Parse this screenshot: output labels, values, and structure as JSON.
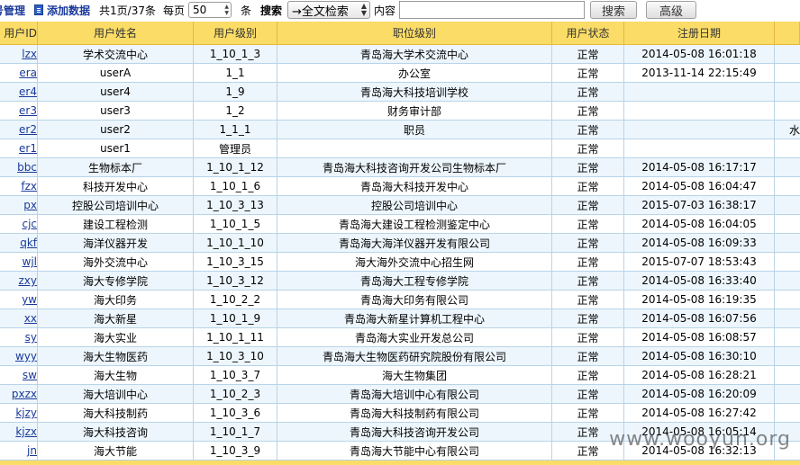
{
  "toolbar": {
    "title": "号管理",
    "add_label": "添加数据",
    "page_info": "共1页/37条",
    "per_page_label": "每页",
    "page_size": "50",
    "unit_label": "条",
    "search_label": "搜索",
    "search_mode": "→全文检索",
    "content_label": "内容",
    "content_value": "",
    "search_button": "搜索",
    "advanced_button": "高级"
  },
  "table": {
    "headers": [
      "用户ID",
      "用户姓名",
      "用户级别",
      "职位级别",
      "用户状态",
      "注册日期",
      ""
    ],
    "rows": [
      [
        "lzx",
        "学术交流中心",
        "1_10_1_3",
        "青岛海大学术交流中心",
        "正常",
        "2014-05-08 16:01:18",
        ""
      ],
      [
        "era",
        "userA",
        "1_1",
        "办公室",
        "正常",
        "2013-11-14 22:15:49",
        ""
      ],
      [
        "er4",
        "user4",
        "1_9",
        "青岛海大科技培训学校",
        "正常",
        "",
        ""
      ],
      [
        "er3",
        "user3",
        "1_2",
        "财务审计部",
        "正常",
        "",
        ""
      ],
      [
        "er2",
        "user2",
        "1_1_1",
        "职员",
        "正常",
        "",
        "水"
      ],
      [
        "er1",
        "user1",
        "管理员",
        "",
        "正常",
        "",
        ""
      ],
      [
        "bbc",
        "生物标本厂",
        "1_10_1_12",
        "青岛海大科技咨询开发公司生物标本厂",
        "正常",
        "2014-05-08 16:17:17",
        ""
      ],
      [
        "fzx",
        "科技开发中心",
        "1_10_1_6",
        "青岛海大科技开发中心",
        "正常",
        "2014-05-08 16:04:47",
        ""
      ],
      [
        "px",
        "控股公司培训中心",
        "1_10_3_13",
        "控股公司培训中心",
        "正常",
        "2015-07-03 16:38:17",
        ""
      ],
      [
        "cjc",
        "建设工程检测",
        "1_10_1_5",
        "青岛海大建设工程检测鉴定中心",
        "正常",
        "2014-05-08 16:04:05",
        ""
      ],
      [
        "qkf",
        "海洋仪器开发",
        "1_10_1_10",
        "青岛海大海洋仪器开发有限公司",
        "正常",
        "2014-05-08 16:09:33",
        ""
      ],
      [
        "wjl",
        "海外交流中心",
        "1_10_3_15",
        "海大海外交流中心招生网",
        "正常",
        "2015-07-07 18:53:43",
        ""
      ],
      [
        "zxy",
        "海大专修学院",
        "1_10_3_12",
        "青岛海大工程专修学院",
        "正常",
        "2014-05-08 16:33:40",
        ""
      ],
      [
        "yw",
        "海大印务",
        "1_10_2_2",
        "青岛海大印务有限公司",
        "正常",
        "2014-05-08 16:19:35",
        ""
      ],
      [
        "xx",
        "海大新星",
        "1_10_1_9",
        "青岛海大新星计算机工程中心",
        "正常",
        "2014-05-08 16:07:56",
        ""
      ],
      [
        "sy",
        "海大实业",
        "1_10_1_11",
        "青岛海大实业开发总公司",
        "正常",
        "2014-05-08 16:08:57",
        ""
      ],
      [
        "wyy",
        "海大生物医药",
        "1_10_3_10",
        "青岛海大生物医药研究院股份有限公司",
        "正常",
        "2014-05-08 16:30:10",
        ""
      ],
      [
        "sw",
        "海大生物",
        "1_10_3_7",
        "海大生物集团",
        "正常",
        "2014-05-08 16:28:21",
        ""
      ],
      [
        "pxzx",
        "海大培训中心",
        "1_10_2_3",
        "青岛海大培训中心有限公司",
        "正常",
        "2014-05-08 16:20:09",
        ""
      ],
      [
        "kjzy",
        "海大科技制药",
        "1_10_3_6",
        "青岛海大科技制药有限公司",
        "正常",
        "2014-05-08 16:27:42",
        ""
      ],
      [
        "kjzx",
        "海大科技咨询",
        "1_10_1_7",
        "青岛海大科技咨询开发公司",
        "正常",
        "2014-05-08 16:05:14",
        ""
      ],
      [
        "jn",
        "海大节能",
        "1_10_3_9",
        "青岛海大节能中心有限公司",
        "正常",
        "2014-05-08 16:32:13",
        ""
      ]
    ]
  },
  "watermark": "www.wooyun.org"
}
